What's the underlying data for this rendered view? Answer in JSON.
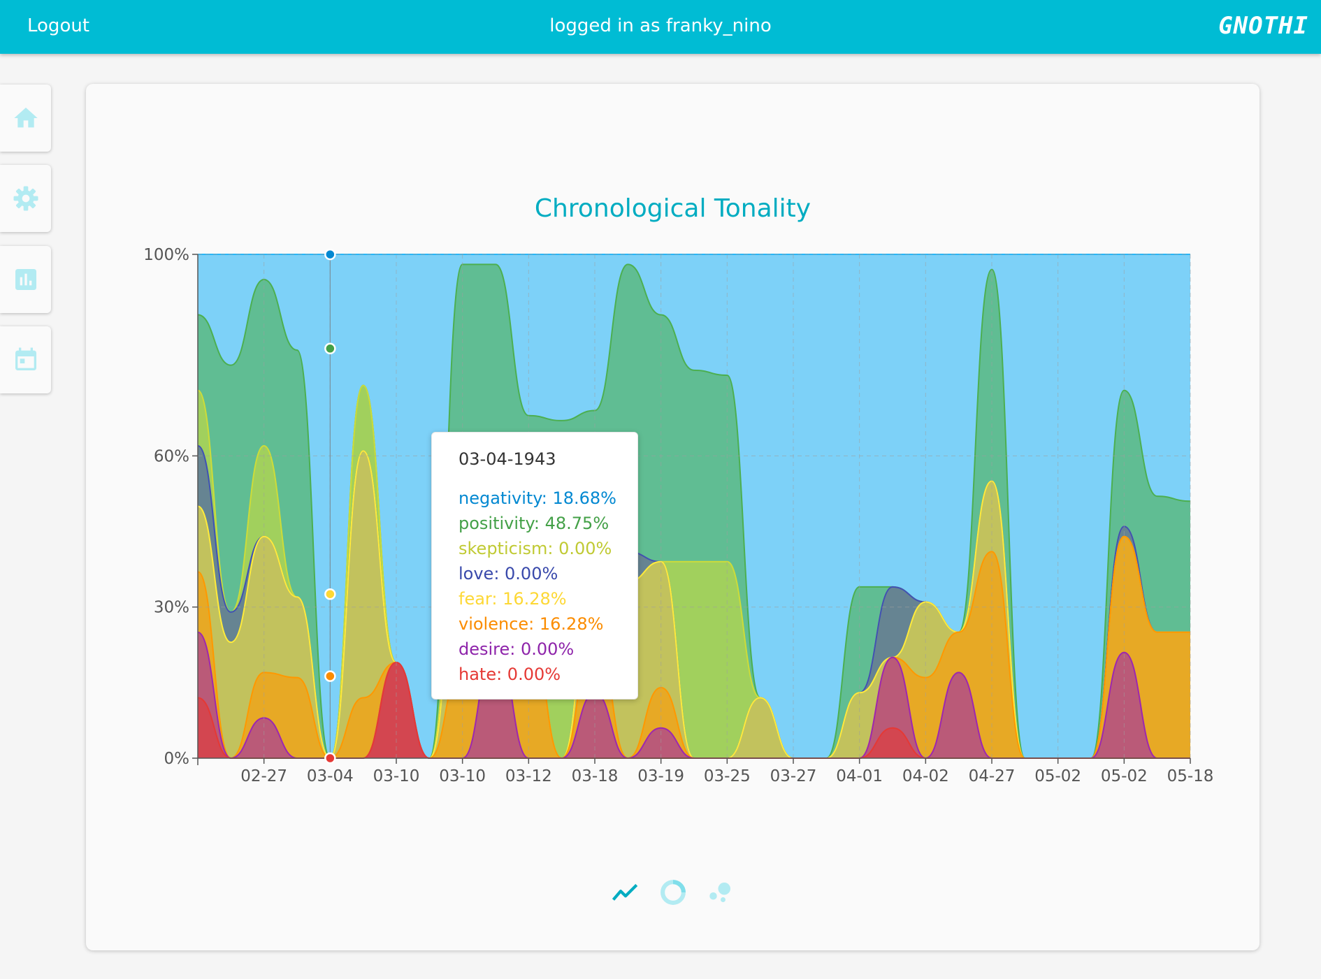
{
  "topbar": {
    "logout_label": "Logout",
    "status_text": "logged in as franky_nino",
    "brand": "GNOTHI",
    "color": "#00bcd4"
  },
  "sidebar": {
    "items": [
      {
        "name": "home",
        "icon": "home-icon"
      },
      {
        "name": "settings",
        "icon": "gear-icon"
      },
      {
        "name": "stats",
        "icon": "bar-chart-icon"
      },
      {
        "name": "calendar",
        "icon": "calendar-icon"
      }
    ],
    "icon_color": "#b2ebf2"
  },
  "chart_data": {
    "type": "area",
    "stacked": true,
    "normalized": true,
    "title": "Chronological Tonality",
    "y_ticks": [
      "0%",
      "30%",
      "60%",
      "100%"
    ],
    "ylim": [
      0,
      1
    ],
    "x_tick_labels": [
      "02-27",
      "03-04",
      "03-10",
      "03-10",
      "03-12",
      "03-18",
      "03-19",
      "03-25",
      "03-27",
      "04-01",
      "04-02",
      "04-27",
      "05-02",
      "05-02",
      "05-18"
    ],
    "grid": true,
    "series": [
      {
        "name": "hate",
        "color": "#e53935",
        "values": [
          0.12,
          0.0,
          0.0,
          0.0,
          0.0,
          0.0,
          0.19,
          0.0,
          0.0,
          0.0,
          0.0,
          0.0,
          0.0,
          0.0,
          0.0,
          0.0,
          0.0,
          0.0,
          0.0,
          0.0,
          0.0,
          0.06,
          0.0,
          0.0,
          0.0,
          0.0,
          0.0,
          0.0,
          0.0,
          0.0,
          0.0
        ]
      },
      {
        "name": "desire",
        "color": "#9c27b0",
        "values": [
          0.13,
          0.0,
          0.08,
          0.0,
          0.0,
          0.0,
          0.0,
          0.0,
          0.0,
          0.23,
          0.0,
          0.0,
          0.13,
          0.0,
          0.06,
          0.0,
          0.0,
          0.0,
          0.0,
          0.0,
          0.0,
          0.14,
          0.0,
          0.17,
          0.0,
          0.0,
          0.0,
          0.0,
          0.21,
          0.0,
          0.0
        ]
      },
      {
        "name": "violence",
        "color": "#ff9800",
        "values": [
          0.12,
          0.0,
          0.09,
          0.16,
          0.0,
          0.12,
          0.0,
          0.0,
          0.19,
          0.0,
          0.27,
          0.0,
          0.13,
          0.0,
          0.08,
          0.0,
          0.0,
          0.0,
          0.0,
          0.0,
          0.0,
          0.0,
          0.16,
          0.08,
          0.41,
          0.0,
          0.0,
          0.0,
          0.23,
          0.25,
          0.25
        ]
      },
      {
        "name": "fear",
        "color": "#ffeb3b",
        "values": [
          0.13,
          0.23,
          0.27,
          0.16,
          0.0,
          0.49,
          0.0,
          0.0,
          0.27,
          0.39,
          0.0,
          0.0,
          0.12,
          0.35,
          0.25,
          0.0,
          0.0,
          0.12,
          0.0,
          0.0,
          0.13,
          0.0,
          0.15,
          0.0,
          0.14,
          0.0,
          0.0,
          0.0,
          0.0,
          0.0,
          0.0
        ]
      },
      {
        "name": "love",
        "color": "#3f51b5",
        "values": [
          0.12,
          0.06,
          0.0,
          0.0,
          0.0,
          0.0,
          0.0,
          0.0,
          0.0,
          0.0,
          0.0,
          0.0,
          0.0,
          0.06,
          0.0,
          0.0,
          0.0,
          0.0,
          0.0,
          0.0,
          0.0,
          0.14,
          0.0,
          0.0,
          0.0,
          0.0,
          0.0,
          0.0,
          0.02,
          0.0,
          0.0
        ]
      },
      {
        "name": "skepticism",
        "color": "#cddc39",
        "values": [
          0.11,
          0.0,
          0.18,
          0.0,
          0.0,
          0.13,
          0.0,
          0.0,
          0.13,
          0.0,
          0.22,
          0.36,
          0.15,
          0.0,
          0.0,
          0.39,
          0.39,
          0.0,
          0.0,
          0.0,
          0.0,
          0.0,
          0.0,
          0.0,
          0.0,
          0.0,
          0.0,
          0.0,
          0.0,
          0.0,
          0.0
        ]
      },
      {
        "name": "positivity",
        "color": "#4caf50",
        "values": [
          0.15,
          0.49,
          0.33,
          0.49,
          0.0,
          0.0,
          0.0,
          0.0,
          0.39,
          0.36,
          0.19,
          0.31,
          0.16,
          0.57,
          0.49,
          0.38,
          0.37,
          0.0,
          0.0,
          0.0,
          0.21,
          0.0,
          0.0,
          0.0,
          0.42,
          0.0,
          0.0,
          0.0,
          0.27,
          0.27,
          0.26
        ]
      },
      {
        "name": "negativity",
        "color": "#29b6f6",
        "values": [
          0.12,
          0.22,
          0.05,
          0.19,
          1.0,
          0.26,
          0.81,
          1.0,
          0.02,
          0.02,
          0.32,
          0.33,
          0.31,
          0.02,
          0.2,
          0.23,
          0.24,
          0.88,
          1.0,
          1.0,
          0.66,
          0.66,
          0.69,
          0.75,
          0.03,
          1.0,
          1.0,
          1.0,
          0.27,
          0.48,
          0.49
        ]
      }
    ],
    "tooltip": {
      "date": "03-04-1943",
      "rows": [
        {
          "text": "negativity: 18.68%",
          "color": "#0288d1"
        },
        {
          "text": "positivity: 48.75%",
          "color": "#43a047"
        },
        {
          "text": "skepticism: 0.00%",
          "color": "#c0ca33"
        },
        {
          "text": "love: 0.00%",
          "color": "#3949ab"
        },
        {
          "text": "fear: 16.28%",
          "color": "#fdd835"
        },
        {
          "text": "violence: 16.28%",
          "color": "#fb8c00"
        },
        {
          "text": "desire: 0.00%",
          "color": "#8e24aa"
        },
        {
          "text": "hate: 0.00%",
          "color": "#e53935"
        }
      ]
    },
    "highlight_category": "03-04"
  },
  "view_switch": {
    "items": [
      {
        "icon": "line-chart-icon",
        "active": true
      },
      {
        "icon": "donut-chart-icon",
        "active": false
      },
      {
        "icon": "bubble-chart-icon",
        "active": false
      }
    ]
  }
}
